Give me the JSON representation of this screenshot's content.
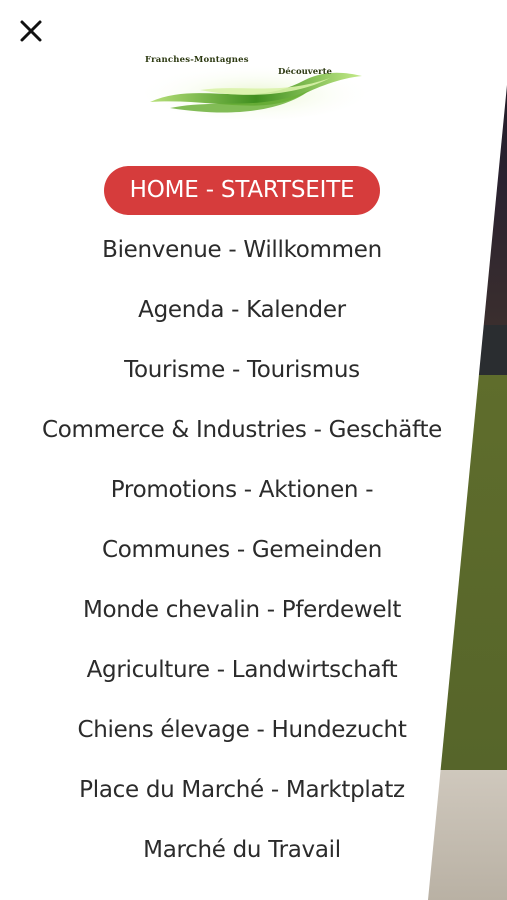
{
  "logo": {
    "line1": "Franches-Montagnes",
    "line2": "Découverte"
  },
  "icons": {
    "close": "close-icon"
  },
  "colors": {
    "accent": "#d63c3c",
    "text": "#2b2b2b"
  },
  "menu": {
    "items": [
      {
        "label": "HOME - STARTSEITE"
      },
      {
        "label": "Bienvenue - Willkommen"
      },
      {
        "label": "Agenda - Kalender"
      },
      {
        "label": "Tourisme - Tourismus"
      },
      {
        "label": "Commerce & Industries - Geschäfte"
      },
      {
        "label": "Promotions - Aktionen -"
      },
      {
        "label": "Communes - Gemeinden"
      },
      {
        "label": "Monde chevalin - Pferdewelt"
      },
      {
        "label": "Agriculture - Landwirtschaft"
      },
      {
        "label": "Chiens élevage - Hundezucht"
      },
      {
        "label": "Place du Marché - Marktplatz"
      },
      {
        "label": "Marché du Travail"
      }
    ]
  }
}
